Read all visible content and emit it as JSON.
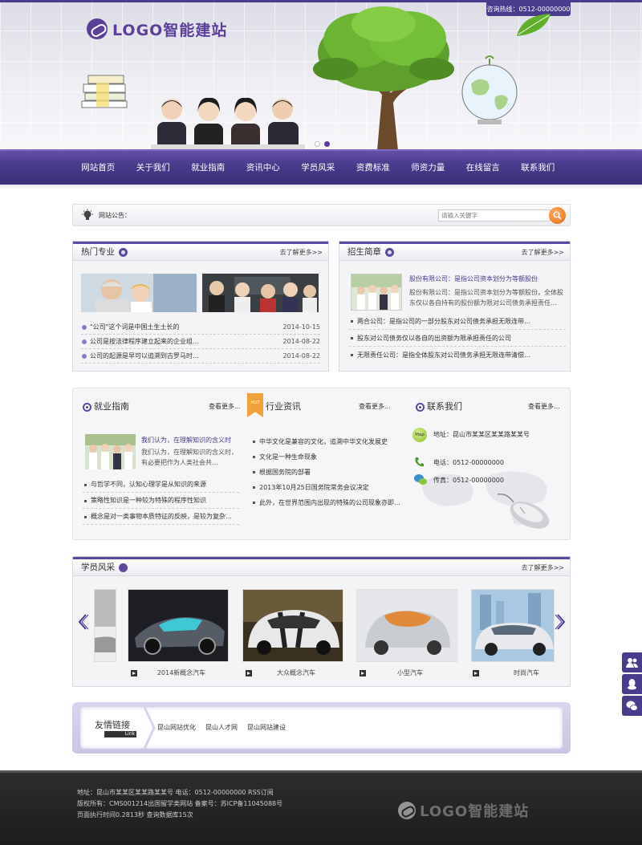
{
  "header": {
    "hotline": "咨询热线：0512-00000000",
    "logo_text": "LOGO智能建站"
  },
  "nav": {
    "items": [
      "网站首页",
      "关于我们",
      "就业指南",
      "资讯中心",
      "学员风采",
      "资费标准",
      "师资力量",
      "在线留言",
      "联系我们"
    ]
  },
  "notice": {
    "label": "网站公告：",
    "search_placeholder": "请输入关键字"
  },
  "hot_major": {
    "title": "热门专业",
    "more": "去了解更多>>",
    "items": [
      {
        "text": "\"公司\"这个词是中国土生土长的",
        "date": "2014-10-15"
      },
      {
        "text": "公司是按法律程序建立起来的企业组…",
        "date": "2014-08-22"
      },
      {
        "text": "公司的起源是早可以追溯到古罗马时…",
        "date": "2014-08-22"
      }
    ]
  },
  "enroll": {
    "title": "招生简章",
    "more": "去了解更多>>",
    "feature_title": "股份有限公司：是指公司资本划分为等额股份",
    "feature_desc": "股份有限公司：是指公司资本划分为等额股份，全体股东仅以各自持有的股份额为限对公司债务承担责任…",
    "items": [
      "两合公司：是指公司的一部分股东对公司债务承担无限连带…",
      "股东对公司债务仅以各自的出资额为限承担责任的公司",
      "无限责任公司：是指全体股东对公司债务承担无限连带清偿…"
    ]
  },
  "job_guide": {
    "title": "就业指南",
    "more": "查看更多...",
    "feature_title": "我们认为，在理解知识的含义时",
    "feature_desc": "我们认为，在理解知识的含义时，有必要把作为人类社会共…",
    "items": [
      "与哲学不同，认知心理学是从知识的来源",
      "策略性知识是一种较为特殊的程序性知识",
      "概念是对一类事物本质特征的反映，是较为复杂…"
    ]
  },
  "industry": {
    "title": "行业资讯",
    "more": "查看更多...",
    "hot": "HOT",
    "items": [
      "中华文化是兼容的文化，追溯中华文化发展史",
      "文化是一种生命现象",
      "根据国务院的部署",
      "2013年10月25日国务院常务会议决定",
      "此外，在世界范围内出现的特殊的公司现象亦即…"
    ]
  },
  "contact": {
    "title": "联系我们",
    "more": "查看更多...",
    "map_badge": "Map",
    "address": "地址：昆山市某某区某某路某某号",
    "phone": "电话：0512-00000000",
    "fax": "传真：0512-00000000"
  },
  "gallery": {
    "title": "学员风采",
    "more": "去了解更多>>",
    "captions": [
      "2014新概念汽车",
      "大众概念汽车",
      "小型汽车",
      "时尚汽车"
    ]
  },
  "links": {
    "label": "友情链接",
    "label_en": "Link",
    "items": [
      "昆山网站优化",
      "昆山人才网",
      "昆山网站建设"
    ]
  },
  "footer": {
    "line1": "地址：昆山市某某区某某路某某号 电话：0512-00000000 RSS订阅",
    "line2": "版权所有：CMS001214出国留学类网站  备案号：苏ICP备11045088号",
    "line3": "页面执行时间0.2813秒  查询数据库15次",
    "logo_text": "LOGO智能建站"
  },
  "colors": {
    "brand": "#4a3b8c",
    "accent": "#e5680e"
  }
}
